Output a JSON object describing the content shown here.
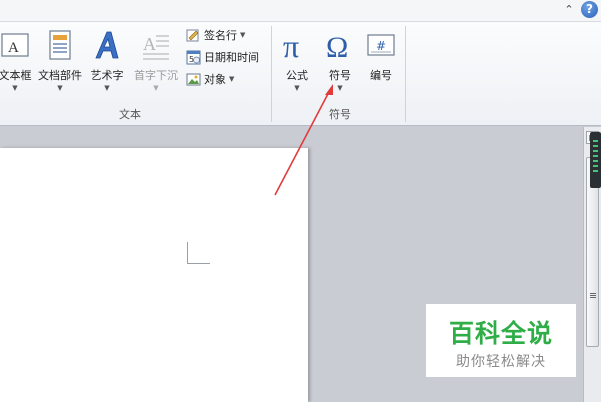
{
  "ribbon": {
    "text_group": {
      "label": "文本",
      "buttons": {
        "textbox": "文本框",
        "quickparts": "文档部件",
        "wordart": "艺术字",
        "dropcap": "首字下沉"
      },
      "small_buttons": {
        "signature": "签名行",
        "datetime": "日期和时间",
        "object": "对象"
      }
    },
    "symbols_group": {
      "label": "符号",
      "buttons": {
        "equation": "公式",
        "symbol": "符号",
        "number": "编号"
      }
    }
  },
  "watermark": {
    "title": "百科全说",
    "subtitle": "助你轻松解决"
  },
  "colors": {
    "accent_arrow": "#e03c3c",
    "watermark_green": "#2fae47"
  }
}
